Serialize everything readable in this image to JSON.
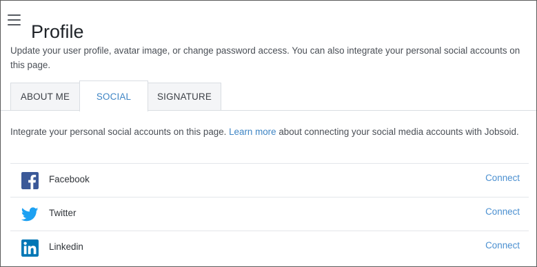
{
  "header": {
    "title": "Profile",
    "menu_icon": "hamburger-menu-icon"
  },
  "intro_text": "Update your user profile, avatar image, or change password access. You can also integrate your personal social accounts on this page.",
  "tabs": [
    {
      "label": "ABOUT ME",
      "active": false
    },
    {
      "label": "SOCIAL",
      "active": true
    },
    {
      "label": "SIGNATURE",
      "active": false
    }
  ],
  "social": {
    "intro_before": "Integrate your personal social accounts on this page. ",
    "intro_link": "Learn more",
    "intro_after": " about connecting your social media accounts with Jobsoid.",
    "accounts": [
      {
        "name": "Facebook",
        "icon": "facebook-icon",
        "action": "Connect",
        "color": "#3b5998"
      },
      {
        "name": "Twitter",
        "icon": "twitter-icon",
        "action": "Connect",
        "color": "#1da1f2"
      },
      {
        "name": "Linkedin",
        "icon": "linkedin-icon",
        "action": "Connect",
        "color": "#0077b5"
      }
    ]
  },
  "colors": {
    "accent": "#3d84c4",
    "border": "#d9dde2",
    "tab_bg": "#f4f5f7"
  }
}
